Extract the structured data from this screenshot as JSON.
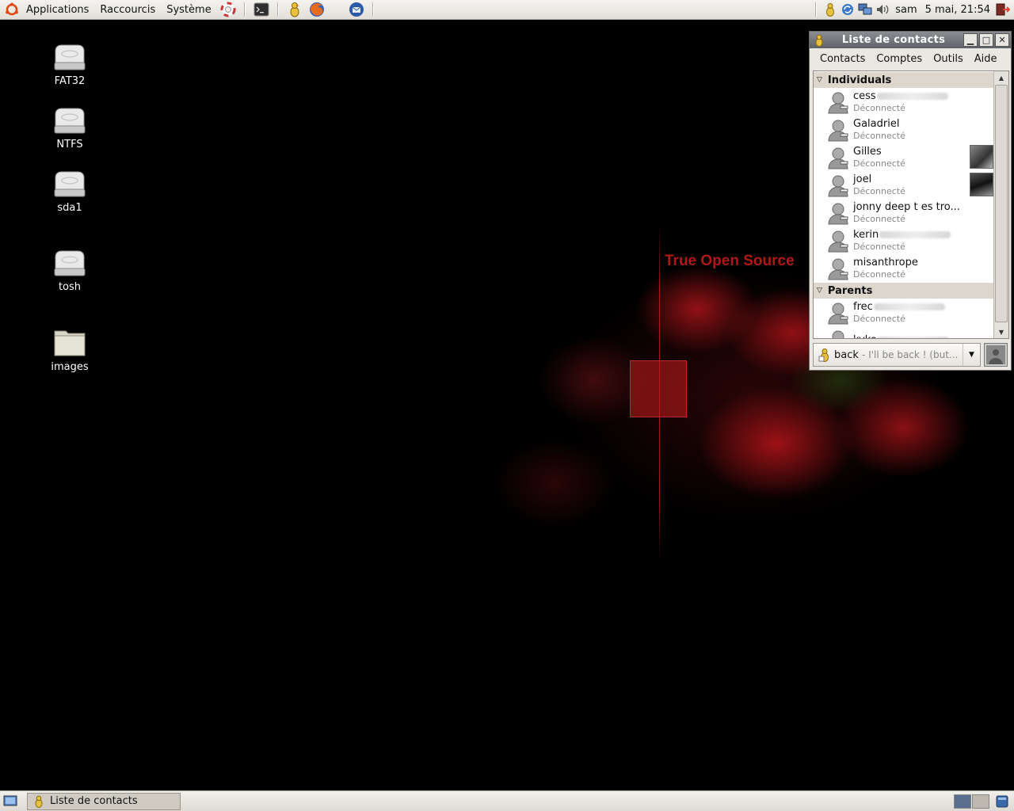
{
  "top_panel": {
    "menus": [
      "Applications",
      "Raccourcis",
      "Système"
    ],
    "launchers": [
      "terminal-icon",
      "pidgin-icon",
      "firefox-icon",
      "thunderbird-icon"
    ],
    "tray": {
      "user": "sam",
      "clock": "5 mai, 21:54"
    }
  },
  "desktop": {
    "icons": [
      {
        "label": "FAT32",
        "icon": "drive-icon"
      },
      {
        "label": "NTFS",
        "icon": "drive-icon"
      },
      {
        "label": "sda1",
        "icon": "drive-icon"
      },
      {
        "label": "tosh",
        "icon": "drive-icon"
      },
      {
        "label": "images",
        "icon": "folder-icon"
      }
    ],
    "wallpaper_text": "True Open Source"
  },
  "buddy_window": {
    "title": "Liste de contacts",
    "menu": [
      "Contacts",
      "Comptes",
      "Outils",
      "Aide"
    ],
    "groups": [
      {
        "name": "Individuals",
        "contacts": [
          {
            "name": "cess",
            "status": "Déconnecté"
          },
          {
            "name": "Galadriel",
            "status": "Déconnecté"
          },
          {
            "name": "Gilles",
            "status": "Déconnecté"
          },
          {
            "name": "joel",
            "status": "Déconnecté"
          },
          {
            "name": "jonny deep t es tro...",
            "status": "Déconnecté"
          },
          {
            "name": "kerin",
            "status": "Déconnecté"
          },
          {
            "name": "misanthrope",
            "status": "Déconnecté"
          }
        ]
      },
      {
        "name": "Parents",
        "contacts": [
          {
            "name": "frec",
            "status": "Déconnecté"
          },
          {
            "name": "kyko",
            "status": ""
          }
        ]
      }
    ],
    "status_selector": {
      "label": "back",
      "message": "- I'll be back ! (but..."
    }
  },
  "bottom_panel": {
    "task": "Liste de contacts"
  },
  "colors": {
    "wallpaper_accent": "#b01818",
    "titlebar": "#6f7277",
    "group_header": "#dcd6cc"
  }
}
